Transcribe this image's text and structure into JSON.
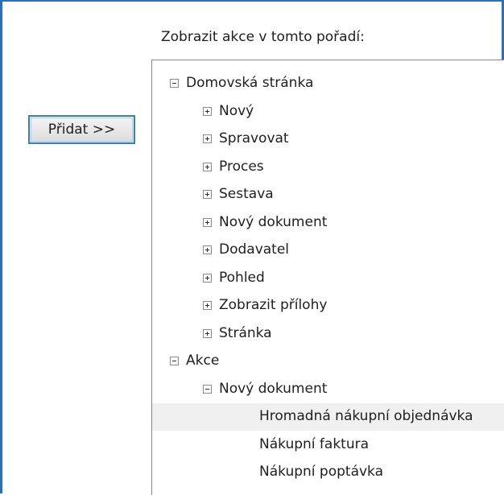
{
  "caption": "Zobrazit akce v tomto pořadí:",
  "add_button_label": "Přidat >>",
  "tree": [
    {
      "label": "Domovská stránka",
      "level": 0,
      "toggle": "minus-icon"
    },
    {
      "label": "Nový",
      "level": 1,
      "toggle": "plus-icon"
    },
    {
      "label": "Spravovat",
      "level": 1,
      "toggle": "plus-icon"
    },
    {
      "label": "Proces",
      "level": 1,
      "toggle": "plus-icon"
    },
    {
      "label": "Sestava",
      "level": 1,
      "toggle": "plus-icon"
    },
    {
      "label": "Nový dokument",
      "level": 1,
      "toggle": "plus-icon"
    },
    {
      "label": "Dodavatel",
      "level": 1,
      "toggle": "plus-icon"
    },
    {
      "label": "Pohled",
      "level": 1,
      "toggle": "plus-icon"
    },
    {
      "label": "Zobrazit přílohy",
      "level": 1,
      "toggle": "plus-icon"
    },
    {
      "label": "Stránka",
      "level": 1,
      "toggle": "plus-icon"
    },
    {
      "label": "Akce",
      "level": 0,
      "toggle": "minus-icon"
    },
    {
      "label": "Nový dokument",
      "level": 1,
      "toggle": "minus-icon"
    },
    {
      "label": "Hromadná nákupní objednávka",
      "level": 2,
      "toggle": null,
      "selected": true
    },
    {
      "label": "Nákupní faktura",
      "level": 2,
      "toggle": null
    },
    {
      "label": "Nákupní poptávka",
      "level": 2,
      "toggle": null
    }
  ],
  "colors": {
    "frame_border": "#2f6fb7",
    "button_border": "#3c7fb1",
    "panel_border": "#828790",
    "selected_row": "#f0f0f0"
  }
}
